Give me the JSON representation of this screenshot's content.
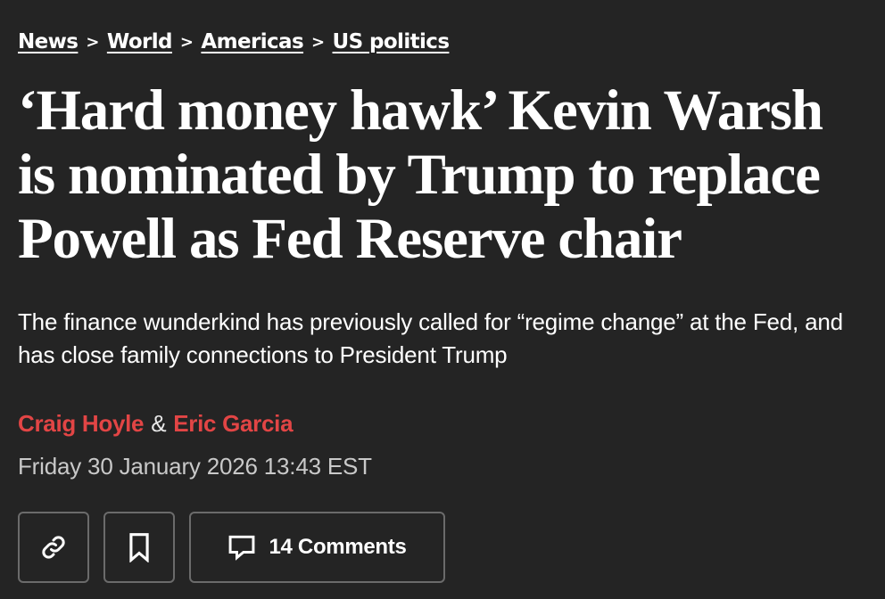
{
  "breadcrumb": {
    "items": [
      {
        "label": "News"
      },
      {
        "label": "World"
      },
      {
        "label": "Americas"
      },
      {
        "label": "US politics"
      }
    ],
    "separator": ">"
  },
  "article": {
    "headline": "‘Hard money hawk’ Kevin Warsh is nominated by Trump to replace Powell as Fed Reserve chair",
    "standfirst": "The finance wunderkind has previously called for “regime change” at the Fed, and has close family connections to President Trump",
    "authors": [
      "Craig Hoyle",
      "Eric Garcia"
    ],
    "author_separator": "&",
    "date": "Friday 30 January 2026 13:43 EST"
  },
  "actions": {
    "copy_link_icon": "link-icon",
    "bookmark_icon": "bookmark-icon",
    "comments_icon": "comment-icon",
    "comments_label": "14 Comments"
  },
  "colors": {
    "background": "#242424",
    "text": "#ffffff",
    "author": "#e24545",
    "date": "#c9c9c9",
    "button_border": "#6b6b6b"
  }
}
